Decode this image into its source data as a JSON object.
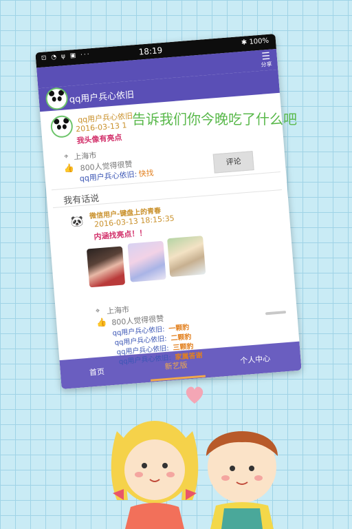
{
  "status": {
    "icons_left": "⊡ ◔ ψ ▣ ···",
    "time": "18:19",
    "bluetooth": "✱",
    "battery": "100%"
  },
  "appbar": {
    "share_label": "分享"
  },
  "header_user": {
    "name": "qq用户兵心依旧"
  },
  "post1": {
    "author": "qq用户兵心依旧",
    "date": "2016-03-13 1",
    "text": "我头像有亮点",
    "location": "上海市",
    "likes": "800人觉得很赞",
    "comments": [
      {
        "user": "qq用户兵心依旧:",
        "text": "快找"
      }
    ],
    "comment_button": "评论"
  },
  "section_title": "我有话说",
  "post2": {
    "author": "微信用户-键盘上的青春",
    "date": "2016-03-13 18:15:35",
    "text": "内涵找亮点！！",
    "location": "上海市",
    "likes": "800人觉得很赞",
    "comments": [
      {
        "user": "qq用户兵心依旧:",
        "text": "一颗豹"
      },
      {
        "user": "qq用户兵心依旧:",
        "text": "二颗豹"
      },
      {
        "user": "qq用户兵心依旧:",
        "text": "三颗豹"
      },
      {
        "user": "qq用户兵心依旧:",
        "text": "家属答谢"
      }
    ]
  },
  "tabs": [
    {
      "label": "首页",
      "active": false
    },
    {
      "label": "新艺版",
      "active": true
    },
    {
      "label": "个人中心",
      "active": false
    }
  ],
  "overlay_caption": "告诉我们你今晚吃了什么吧",
  "colors": {
    "accent": "#5a4fb6",
    "tab_active": "#f0a94a",
    "overlay": "#58b84a",
    "pink": "#d2306a",
    "gold": "#c9902a"
  },
  "icons": [
    "location-icon",
    "like-icon",
    "menu-icon",
    "heart-icon"
  ]
}
